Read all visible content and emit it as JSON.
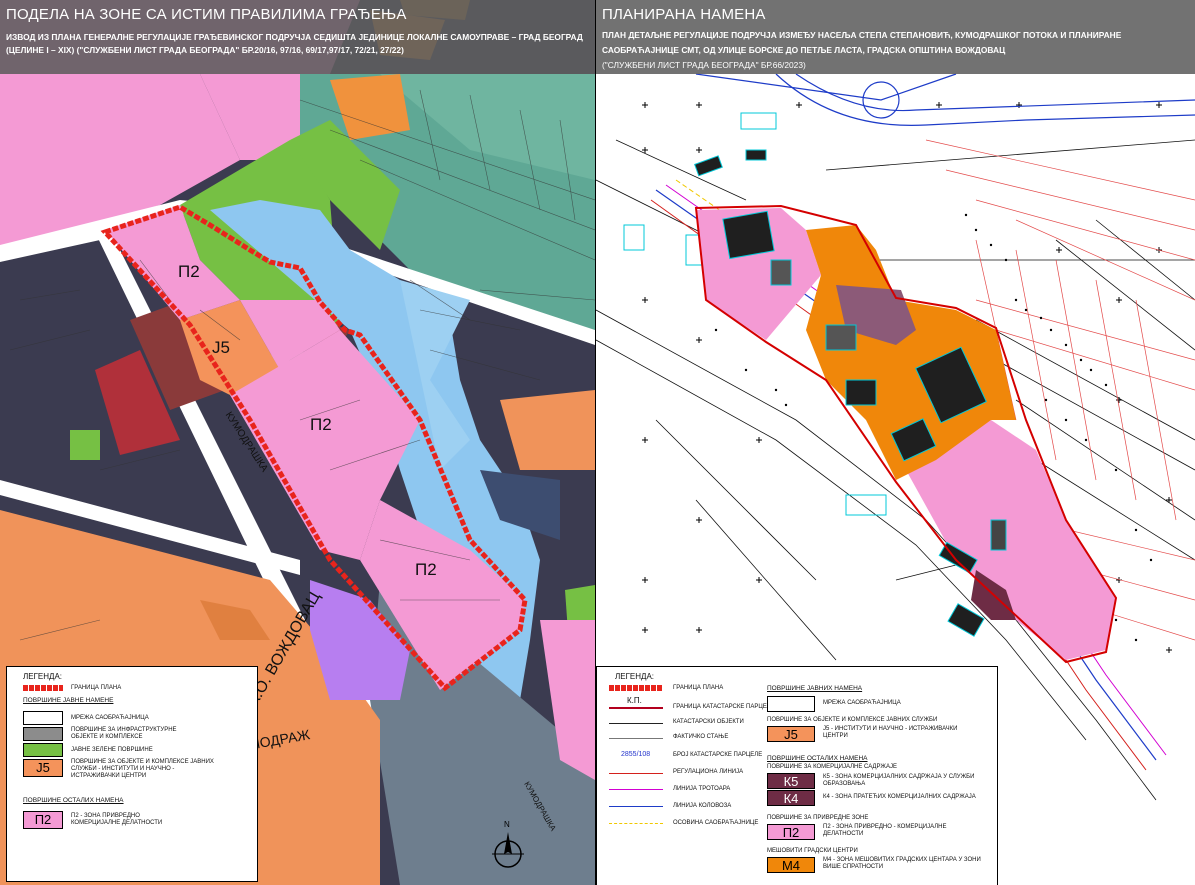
{
  "left": {
    "title": "ПОДЕЛА НА ЗОНЕ СА ИСТИМ ПРАВИЛИМА ГРАЂЕЊА",
    "subtitle_lines": [
      "ИЗВОД ИЗ ПЛАНА ГЕНЕРАЛНЕ РЕГУЛАЦИЈЕ ГРАЂЕВИНСКОГ ПОДРУЧЈА СЕДИШТА ЈЕДИНИЦЕ ЛОКАЛНЕ САМОУПРАВЕ – ГРАД БЕОГРАД",
      "(ЦЕЛИНЕ I – XIX) (\"СЛУЖБЕНИ ЛИСТ ГРАДА БЕОГРАДА\" БР.20/16, 97/16, 69/17,97/17, 72/21, 27/22)"
    ],
    "zone_labels": [
      "П2",
      "Ј5",
      "П2",
      "П2"
    ],
    "road_labels": [
      "КУМОДРАШКА",
      "К.О. ВОЖДОВАЦ",
      "КУМОДРАЖ",
      "КУМОДРАШКА"
    ],
    "legend": {
      "title": "ЛЕГЕНДА:",
      "boundary": "ГРАНИЦА ПЛАНА",
      "public_header": "ПОВРШИНЕ ЈАВНЕ НАМЕНЕ",
      "items": [
        {
          "label": "МРЕЖА САОБРАЋАЈНИЦА",
          "color": "#ffffff",
          "code": ""
        },
        {
          "label": "ПОВРШИНЕ ЗА ИНФРАСТРУКТУРНЕ ОБЈЕКТЕ И КОМПЛЕКСЕ",
          "color": "#8c8c8c",
          "code": ""
        },
        {
          "label": "ЈАВНЕ ЗЕЛЕНЕ ПОВРШИНЕ",
          "color": "#76c044",
          "code": ""
        },
        {
          "label": "ПОВРШИНЕ ЗА ОБЈЕКТЕ И КОМПЛЕКСЕ ЈАВНИХ СЛУЖБИ - ИНСТИТУТИ И НАУЧНО - ИСТРАЖИВАЧКИ ЦЕНТРИ",
          "color": "#f4935b",
          "code": "Ј5"
        }
      ],
      "other_header": "ПОВРШИНЕ ОСТАЛИХ НАМЕНА",
      "other_items": [
        {
          "label": "П2 - ЗОНА ПРИВРЕДНО КОМЕРЦИЈАЛНЕ ДЕЛАТНОСТИ",
          "color": "#f49ad4",
          "code": "П2"
        }
      ]
    }
  },
  "right": {
    "title": "ПЛАНИРАНА НАМЕНА",
    "subtitle_lines": [
      "ПЛАН ДЕТАЉНЕ РЕГУЛАЦИЈЕ ПОДРУЧЈА ИЗМЕЂУ НАСЕЉА СТЕПА СТЕПАНОВИЋ, КУМОДРАШКОГ ПОТОКА И ПЛАНИРАНЕ",
      "САОБРАЋАЈНИЦЕ СМТ, ОД УЛИЦЕ БОРСКЕ ДО ПЕТЉЕ ЛАСТА, ГРАДСКА ОПШТИНА ВОЖДОВАЦ",
      "(\"СЛУЖБЕНИ ЛИСТ ГРАДА БЕОГРАДА\" БР.66/2023)"
    ],
    "legend": {
      "title": "ЛЕГЕНДА:",
      "lines": [
        {
          "label": "ГРАНИЦА ПЛАНА",
          "color": "#e8241c",
          "style": "thick"
        },
        {
          "label": "ГРАНИЦА КАТАСТАРСКЕ ПАРЦЕЛЕ",
          "color": "#b3001e",
          "style": "kp",
          "tag": "К.П."
        },
        {
          "label": "КАТАСТАРСКИ ОБЈЕКТИ",
          "color": "#222222",
          "style": "thin"
        },
        {
          "label": "ФАКТИЧКО СТАЊЕ",
          "color": "#777777",
          "style": "thin"
        },
        {
          "label": "БРОЈ КАТАСТАРСКЕ ПАРЦЕЛЕ",
          "color": "#2233cc",
          "style": "text",
          "tag": "2855/108"
        },
        {
          "label": "РЕГУЛАЦИОНА ЛИНИЈА",
          "color": "#d4201c",
          "style": "thin"
        },
        {
          "label": "ЛИНИЈА ТРОТОАРА",
          "color": "#d200d2",
          "style": "thin"
        },
        {
          "label": "ЛИНИЈА КОЛОВОЗА",
          "color": "#1e3cc8",
          "style": "thin"
        },
        {
          "label": "ОСОВИНА САОБРАЋАЈНИЦЕ",
          "color": "#f0c800",
          "style": "dash"
        }
      ],
      "public_header": "ПОВРШИНЕ ЈАВНИХ НАМЕНА",
      "road_item": "МРЕЖА САОБРАЋАЈНИЦА",
      "services_header": "ПОВРШИНЕ ЗА ОБЈЕКТЕ И КОМПЛЕКСЕ ЈАВНИХ СЛУЖБИ",
      "j5_item": {
        "code": "Ј5",
        "label": "Ј5 - ИНСТИТУТИ И НАУЧНО - ИСТРАЖИВАЧКИ ЦЕНТРИ",
        "color": "#f4935b"
      },
      "other_header": "ПОВРШИНЕ ОСТАЛИХ НАМЕНА",
      "commercial_header": "ПОВРШИНЕ ЗА КОМЕРЦИЈАЛНЕ САДРЖАЈЕ",
      "k5_item": {
        "code": "К5",
        "label": "К5 - ЗОНА КОМЕРЦИЈАЛНИХ САДРЖАЈА У СЛУЖБИ ОБРАЗОВАЊА",
        "color": "#6e2c45"
      },
      "k4_item": {
        "code": "К4",
        "label": "К4 - ЗОНА ПРАТЕЋИХ КОМЕРЦИЈАЛНИХ САДРЖАЈА",
        "color": "#6e2c45"
      },
      "industry_header": "ПОВРШИНЕ ЗА ПРИВРЕДНЕ ЗОНЕ",
      "p2_item": {
        "code": "П2",
        "label": "П2 - ЗОНА ПРИВРЕДНО - КОМЕРЦИЈАЛНЕ ДЕЛАТНОСТИ",
        "color": "#f49ad4"
      },
      "mixed_header": "МЕШОВИТИ ГРАДСКИ ЦЕНТРИ",
      "m4_item": {
        "code": "М4",
        "label": "М4 - ЗОНА МЕШОВИТИХ ГРАДСКИХ ЦЕНТАРА У ЗОНИ ВИШЕ СПРАТНОСТИ",
        "color": "#f0870a"
      }
    }
  },
  "compass_label": "N"
}
